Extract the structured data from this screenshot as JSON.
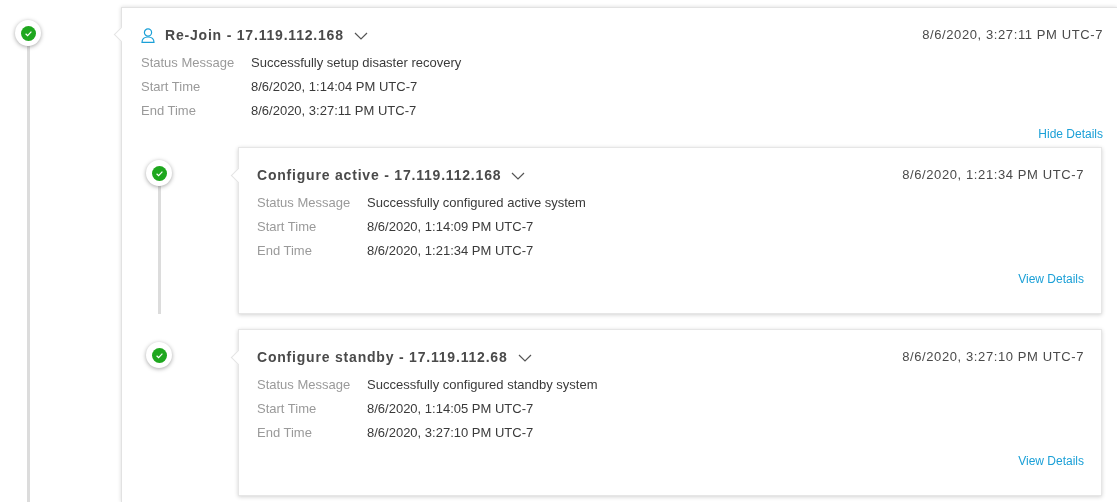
{
  "step": {
    "title": "Re-Join - 17.119.112.168",
    "complete": true,
    "timestamp": "8/6/2020, 3:27:11 PM UTC-7",
    "fields": [
      {
        "label": "Status Message",
        "value": "Successfully setup disaster recovery"
      },
      {
        "label": "Start Time",
        "value": "8/6/2020, 1:14:04 PM UTC-7"
      },
      {
        "label": "End Time",
        "value": "8/6/2020, 3:27:11 PM UTC-7"
      }
    ],
    "details_link": "Hide Details",
    "children": [
      {
        "title": "Configure active - 17.119.112.168",
        "complete": true,
        "timestamp": "8/6/2020, 1:21:34 PM UTC-7",
        "fields": [
          {
            "label": "Status Message",
            "value": "Successfully configured active system"
          },
          {
            "label": "Start Time",
            "value": "8/6/2020, 1:14:09 PM UTC-7"
          },
          {
            "label": "End Time",
            "value": "8/6/2020, 1:21:34 PM UTC-7"
          }
        ],
        "details_link": "View Details"
      },
      {
        "title": "Configure standby - 17.119.112.68",
        "complete": true,
        "timestamp": "8/6/2020, 3:27:10 PM UTC-7",
        "fields": [
          {
            "label": "Status Message",
            "value": "Successfully configured standby system"
          },
          {
            "label": "Start Time",
            "value": "8/6/2020, 1:14:05 PM UTC-7"
          },
          {
            "label": "End Time",
            "value": "8/6/2020, 3:27:10 PM UTC-7"
          }
        ],
        "details_link": "View Details"
      }
    ]
  }
}
